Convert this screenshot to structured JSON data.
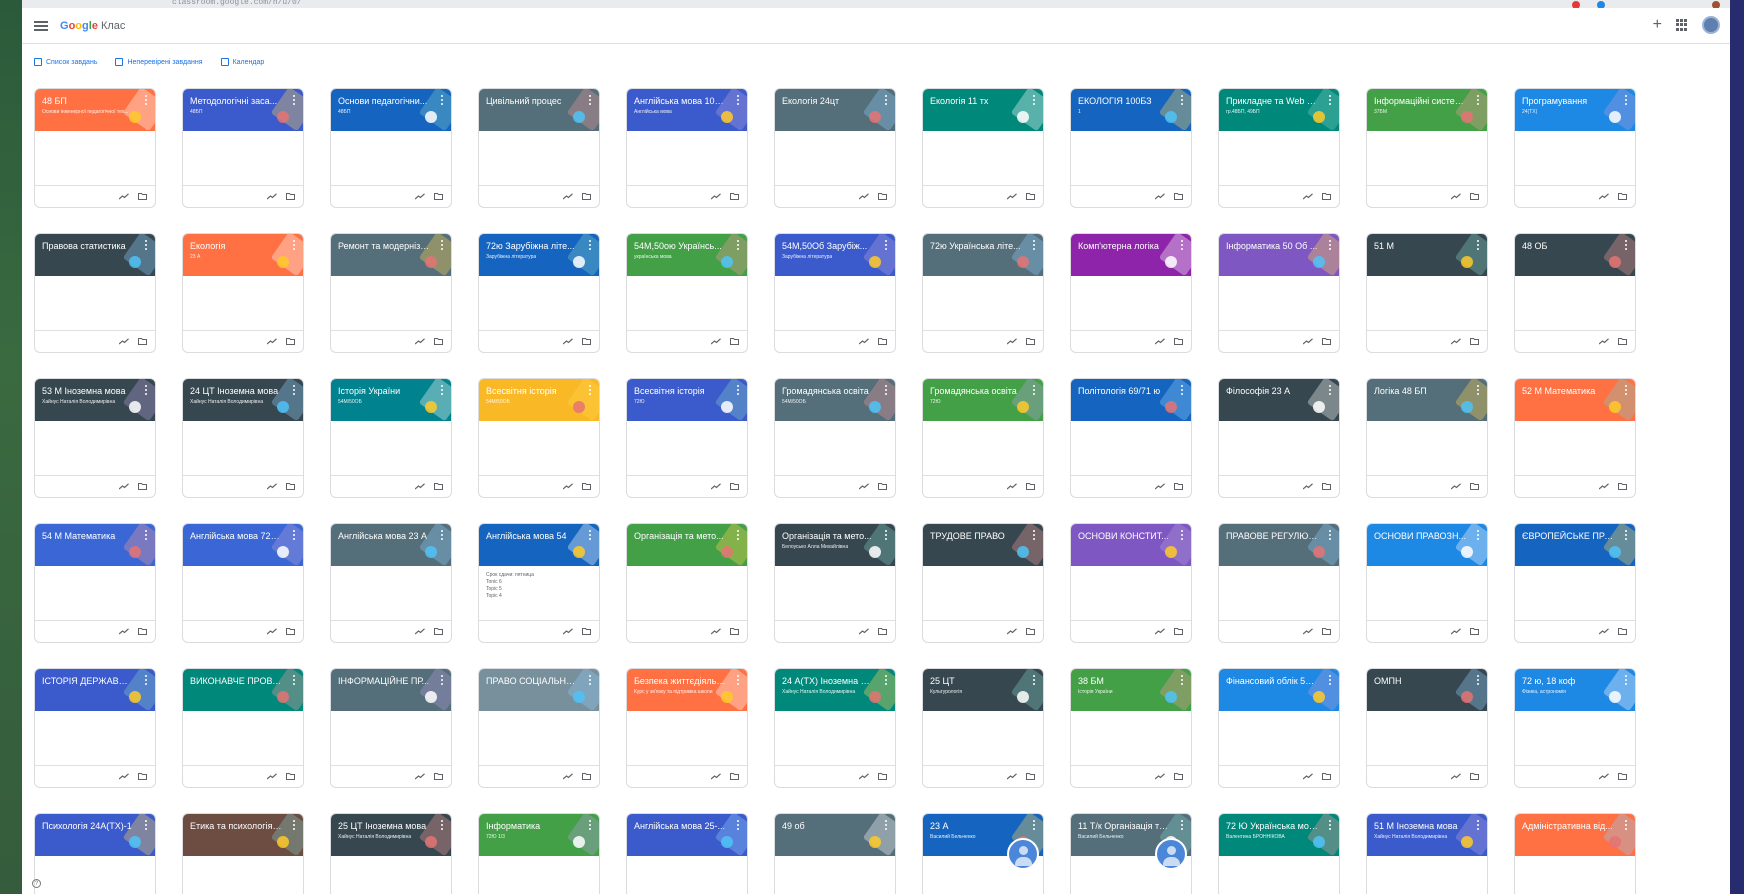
{
  "browser": {
    "url": "classroom.google.com/h/u/0/"
  },
  "app": {
    "brand": "Google",
    "name": "Клас"
  },
  "colors": {
    "orange": "#ff7043",
    "blue": "#3b67d6",
    "deepblue": "#1565c0",
    "slate": "#546e7a",
    "dark": "#37474f",
    "teal": "#00897b",
    "green": "#43a047",
    "purple": "#8e24aa",
    "violet": "#7e57c2",
    "yellow": "#f9b825",
    "brown": "#6d4c41",
    "lightblue": "#1e88e5",
    "gray": "#78909c"
  },
  "subnav": [
    {
      "label": "Список завдань",
      "icon": "assignment-icon"
    },
    {
      "label": "Неперевірені завдання",
      "icon": "review-icon"
    },
    {
      "label": "Календар",
      "icon": "calendar-icon"
    }
  ],
  "cards": [
    {
      "title": "48 БП",
      "sub": "Основи інженерної педагогічної тех...",
      "color": "#ff7043"
    },
    {
      "title": "Методологічні заса...",
      "sub": "48БП",
      "color": "#3b5bcc"
    },
    {
      "title": "Основи педагогічни...",
      "sub": "48БП",
      "color": "#1565c0"
    },
    {
      "title": "Цивільний процес",
      "sub": "",
      "color": "#546e7a"
    },
    {
      "title": "Англійська мова 101-...",
      "sub": "Англійська мова",
      "color": "#3b5bcc"
    },
    {
      "title": "Екологія 24цт",
      "sub": "",
      "color": "#546e7a"
    },
    {
      "title": "Екологія 11 тх",
      "sub": "",
      "color": "#00897b"
    },
    {
      "title": "ЕКОЛОГІЯ 100БЗ",
      "sub": "1",
      "color": "#1565c0"
    },
    {
      "title": "Прикладне та Web п...",
      "sub": "гр.48БП, 49БП",
      "color": "#00897b"
    },
    {
      "title": "Інформаційні систем...",
      "sub": "37БМ",
      "color": "#43a047"
    },
    {
      "title": "Програмування",
      "sub": "24(ТХ)",
      "color": "#1e88e5"
    },
    {
      "title": "Правова статистика",
      "sub": "",
      "color": "#37474f"
    },
    {
      "title": "Екологія",
      "sub": "23 А",
      "color": "#ff7043"
    },
    {
      "title": "Ремонт та модерніза...",
      "sub": "",
      "color": "#546e7a"
    },
    {
      "title": "72ю Зарубіжна літе...",
      "sub": "Зарубіжна література",
      "color": "#1565c0"
    },
    {
      "title": "54М,50ою Українсь...",
      "sub": "українська мова",
      "color": "#43a047"
    },
    {
      "title": "54М,50Об Зарубіж...",
      "sub": "Зарубіжна література",
      "color": "#3b5bcc"
    },
    {
      "title": "72ю Українська літе...",
      "sub": "",
      "color": "#546e7a"
    },
    {
      "title": "Комп'ютерна логіка",
      "sub": "",
      "color": "#8e24aa"
    },
    {
      "title": "Інформатика 50 Об ...",
      "sub": "",
      "color": "#7e57c2"
    },
    {
      "title": "51 М",
      "sub": "",
      "color": "#37474f"
    },
    {
      "title": "48 ОБ",
      "sub": "",
      "color": "#37474f"
    },
    {
      "title": "53 М Іноземна мова",
      "sub": "Хайнус Наталія Володимирівна",
      "color": "#37474f"
    },
    {
      "title": "24 ЦТ Іноземна мова",
      "sub": "Хайнус Наталія Володимирівна",
      "color": "#37474f"
    },
    {
      "title": "Історія України",
      "sub": "54М/50ОБ",
      "color": "#00838f"
    },
    {
      "title": "Всесвітня історія",
      "sub": "54М/50ОБ",
      "color": "#f9b825"
    },
    {
      "title": "Всесвітня історія",
      "sub": "72Ю",
      "color": "#3b5bcc"
    },
    {
      "title": "Громадянська освіта",
      "sub": "54М/50ОБ",
      "color": "#546e7a"
    },
    {
      "title": "Громадянська освіта",
      "sub": "72Ю",
      "color": "#43a047"
    },
    {
      "title": "Політологія 69/71 ю",
      "sub": "",
      "color": "#1565c0"
    },
    {
      "title": "Філософія 23 А",
      "sub": "",
      "color": "#37474f"
    },
    {
      "title": "Логіка 48 БП",
      "sub": "",
      "color": "#546e7a"
    },
    {
      "title": "52 М Математика",
      "sub": "",
      "color": "#ff7043"
    },
    {
      "title": "54 М Математика",
      "sub": "",
      "color": "#3b67d6"
    },
    {
      "title": "Англійська мова 72 Ю",
      "sub": "",
      "color": "#3b67d6"
    },
    {
      "title": "Англійська мова 23 А",
      "sub": "",
      "color": "#546e7a"
    },
    {
      "title": "Англійська мова 54",
      "sub": "",
      "color": "#1565c0",
      "tasks": [
        "Срок сдачи: пятница",
        "Tonic 6",
        "Topic 5",
        "Topic 4"
      ]
    },
    {
      "title": "Організація та мето...",
      "sub": "",
      "color": "#43a047"
    },
    {
      "title": "Організація та мето...",
      "sub": "Белоусько Алла Михайлівна",
      "color": "#37474f"
    },
    {
      "title": "ТРУДОВЕ ПРАВО",
      "sub": "",
      "color": "#37474f"
    },
    {
      "title": "ОСНОВИ КОНСТИТ...",
      "sub": "",
      "color": "#7e57c2"
    },
    {
      "title": "ПРАВОВЕ РЕГУЛЮВ...",
      "sub": "",
      "color": "#546e7a"
    },
    {
      "title": "ОСНОВИ ПРАВОЗН...",
      "sub": "",
      "color": "#1e88e5"
    },
    {
      "title": "ЄВРОПЕЙСЬКЕ ПРА...",
      "sub": "",
      "color": "#1565c0"
    },
    {
      "title": "ІСТОРІЯ ДЕРЖАВИ І ...",
      "sub": "",
      "color": "#3b5bcc"
    },
    {
      "title": "ВИКОНАВЧЕ ПРОВА...",
      "sub": "",
      "color": "#00897b"
    },
    {
      "title": "ІНФОРМАЦІЙНЕ ПР...",
      "sub": "",
      "color": "#546e7a"
    },
    {
      "title": "ПРАВО СОЦІАЛЬНО...",
      "sub": "",
      "color": "#78909c"
    },
    {
      "title": "Безпека життєдіяльн...",
      "sub": "Курс у зв'язку та підтримка школи",
      "color": "#ff7043"
    },
    {
      "title": "24 А(ТХ) Іноземна м...",
      "sub": "Хайнус Наталія Володимирівна",
      "color": "#00897b"
    },
    {
      "title": "25 ЦТ",
      "sub": "Культурологія",
      "color": "#37474f"
    },
    {
      "title": "38 БМ",
      "sub": "Історія України",
      "color": "#43a047"
    },
    {
      "title": "Фінансовий облік 51 ...",
      "sub": "",
      "color": "#1e88e5"
    },
    {
      "title": "ОМПН",
      "sub": "",
      "color": "#37474f"
    },
    {
      "title": "72 ю, 18 коф",
      "sub": "Фізика, астрономія",
      "color": "#1e88e5"
    },
    {
      "title": "Психологія 24А(ТХ)-1",
      "sub": "",
      "color": "#3b5bcc"
    },
    {
      "title": "Етика та психологія ...",
      "sub": "",
      "color": "#6d4c41"
    },
    {
      "title": "25 ЦТ Іноземна мова",
      "sub": "Хайнус Наталія Володимирівна",
      "color": "#37474f"
    },
    {
      "title": "Інформатика",
      "sub": "72Ю 1/3",
      "color": "#43a047"
    },
    {
      "title": "Англійська мова 25-...",
      "sub": "",
      "color": "#3b5bcc"
    },
    {
      "title": "49 об",
      "sub": "",
      "color": "#546e7a"
    },
    {
      "title": "23 А",
      "sub": "Василий Бельченко",
      "color": "#1565c0"
    },
    {
      "title": "11 Т/к Організація та ...",
      "sub": "Василий Бельченко",
      "color": "#546e7a"
    },
    {
      "title": "72 Ю Українська мова",
      "sub": "Валентина БРОННІКОВА",
      "color": "#00897b"
    },
    {
      "title": "51 М Іноземна мова",
      "sub": "Хайнус Наталія Володимирівна",
      "color": "#3b5bcc"
    },
    {
      "title": "Адміністративна від...",
      "sub": "",
      "color": "#ff7043"
    }
  ]
}
